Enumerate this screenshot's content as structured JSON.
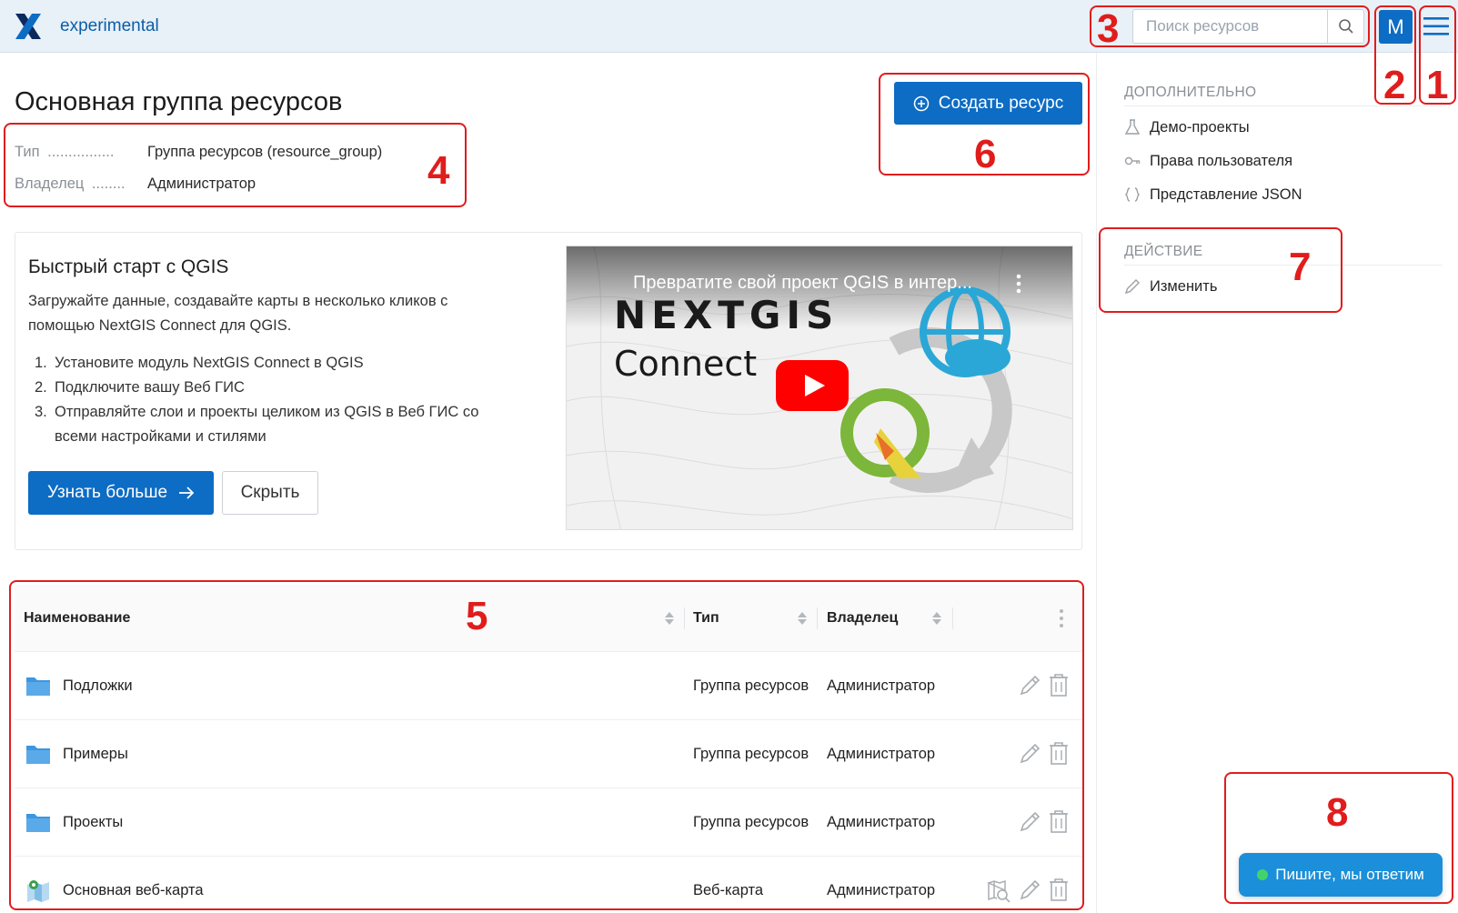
{
  "header": {
    "app_title": "experimental",
    "search_placeholder": "Поиск ресурсов",
    "avatar_letter": "M"
  },
  "resource": {
    "title": "Основная группа ресурсов",
    "type_label": "Тип",
    "type_dots": "................",
    "type_value": "Группа ресурсов (resource_group)",
    "owner_label": "Владелец",
    "owner_dots": "........",
    "owner_value": "Администратор"
  },
  "create_button": "Создать ресурс",
  "quickstart": {
    "title": "Быстрый старт с QGIS",
    "description": "Загружайте данные, создавайте карты в несколько кликов с помощью NextGIS Connect для QGIS.",
    "steps": [
      {
        "num": "1.",
        "text": "Установите модуль NextGIS Connect в QGIS"
      },
      {
        "num": "2.",
        "text": "Подключите вашу Веб ГИС"
      },
      {
        "num": "3.",
        "text": "Отправляйте слои и проекты целиком из QGIS в Веб ГИС со всеми настройками и стилями"
      }
    ],
    "learn_more": "Узнать больше",
    "hide": "Скрыть",
    "video": {
      "title": "Превратите свой проект QGIS в интер...",
      "brand": "NEXTGIS",
      "brand_sub": "Connect"
    }
  },
  "table": {
    "columns": [
      "Наименование",
      "Тип",
      "Владелец"
    ],
    "rows": [
      {
        "name": "Подложки",
        "type": "Группа ресурсов",
        "owner": "Администратор",
        "icon": "folder-icon"
      },
      {
        "name": "Примеры",
        "type": "Группа ресурсов",
        "owner": "Администратор",
        "icon": "folder-icon"
      },
      {
        "name": "Проекты",
        "type": "Группа ресурсов",
        "owner": "Администратор",
        "icon": "folder-icon"
      },
      {
        "name": "Основная веб-карта",
        "type": "Веб-карта",
        "owner": "Администратор",
        "icon": "webmap-icon"
      }
    ]
  },
  "sidebar": {
    "section_extra": "ДОПОЛНИТЕЛЬНО",
    "items_extra": [
      {
        "label": "Демо-проекты",
        "icon": "flask-icon"
      },
      {
        "label": "Права пользователя",
        "icon": "key-icon"
      },
      {
        "label": "Представление JSON",
        "icon": "braces-icon"
      }
    ],
    "section_action": "ДЕЙСТВИЕ",
    "items_action": [
      {
        "label": "Изменить",
        "icon": "pencil-icon"
      }
    ]
  },
  "chat_button": "Пишите, мы ответим",
  "annotations": [
    "1",
    "2",
    "3",
    "4",
    "5",
    "6",
    "7",
    "8"
  ],
  "colors": {
    "primary": "#0d6cc4",
    "annotation": "#e11c1c",
    "header_bg": "#e8f0f8",
    "chat": "#1b8fd9"
  }
}
